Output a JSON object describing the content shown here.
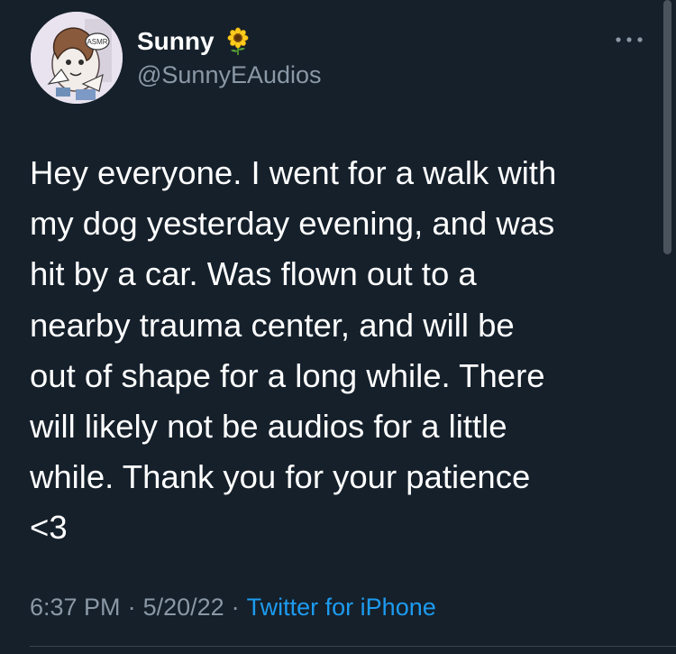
{
  "user": {
    "display_name": "Sunny",
    "name_emoji": "sunflower-icon",
    "handle": "@SunnyEAudios",
    "avatar_badge_text": "ASMR"
  },
  "tweet": {
    "text": "Hey everyone. I went for a walk with\nmy dog yesterday evening, and was\nhit by a car. Was flown out to a\nnearby trauma center, and will be\nout of shape for a long while. There\nwill likely not be audios for a little\nwhile. Thank you for your patience\n<3",
    "time": "6:37 PM",
    "date": "5/20/22",
    "separator": "·",
    "source": "Twitter for iPhone"
  },
  "colors": {
    "background": "#15202b",
    "text_primary": "#ffffff",
    "text_secondary": "#8b98a5",
    "link": "#1d9bf0",
    "divider": "#38444d"
  },
  "icons": {
    "more": "more-horizontal-icon"
  }
}
